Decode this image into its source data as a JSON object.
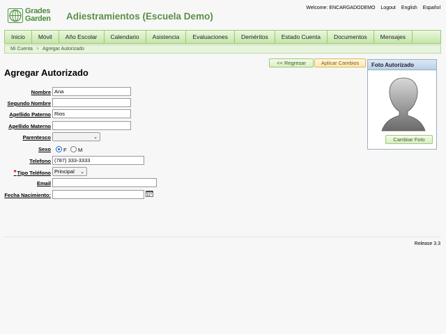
{
  "header": {
    "logo_line1": "Grades",
    "logo_line2": "Garden",
    "school_title": "Adiestramientos (Escuela Demo)",
    "welcome": "Welcome: ENCARGADODEMO",
    "logout": "Logout",
    "lang_en": "English",
    "lang_es": "Español"
  },
  "nav": [
    "Inicio",
    "Móvil",
    "Año Escolar",
    "Calendario",
    "Asistencia",
    "Evaluaciones",
    "Deméritos",
    "Estado Cuenta",
    "Documentos",
    "Mensajes"
  ],
  "breadcrumb": {
    "home": "Mi Cuenta",
    "current": "Agregar Autorizado",
    "separator": ">"
  },
  "page_title": "Agregar Autorizado",
  "buttons": {
    "back": "<< Regresar",
    "apply": "Aplicar Cambios",
    "change_photo": "Cambiar Foto"
  },
  "photo_panel": {
    "title": "Foto Autorizado"
  },
  "form": {
    "nombre": {
      "label": "Nombre",
      "value": "Ana"
    },
    "segundo_nombre": {
      "label": "Segundo Nombre",
      "value": ""
    },
    "apellido_paterno": {
      "label": "Apellido Paterno",
      "value": "Rios"
    },
    "apellido_materno": {
      "label": "Apellido Materno",
      "value": ""
    },
    "parentesco": {
      "label": "Parentesco",
      "value": ""
    },
    "sexo": {
      "label": "Sexo",
      "option_f": "F",
      "option_m": "M",
      "selected": "F"
    },
    "telefono": {
      "label": "Telefono",
      "value": "(787) 333-3333"
    },
    "tipo_telefono": {
      "label": "Tipo Teléfono",
      "required_mark": "*",
      "value": "Principal"
    },
    "email": {
      "label": "Email",
      "value": ""
    },
    "fecha_nacimiento": {
      "label": "Fecha Nacimiento:",
      "value": ""
    }
  },
  "footer": {
    "release": "Release 3.3"
  }
}
